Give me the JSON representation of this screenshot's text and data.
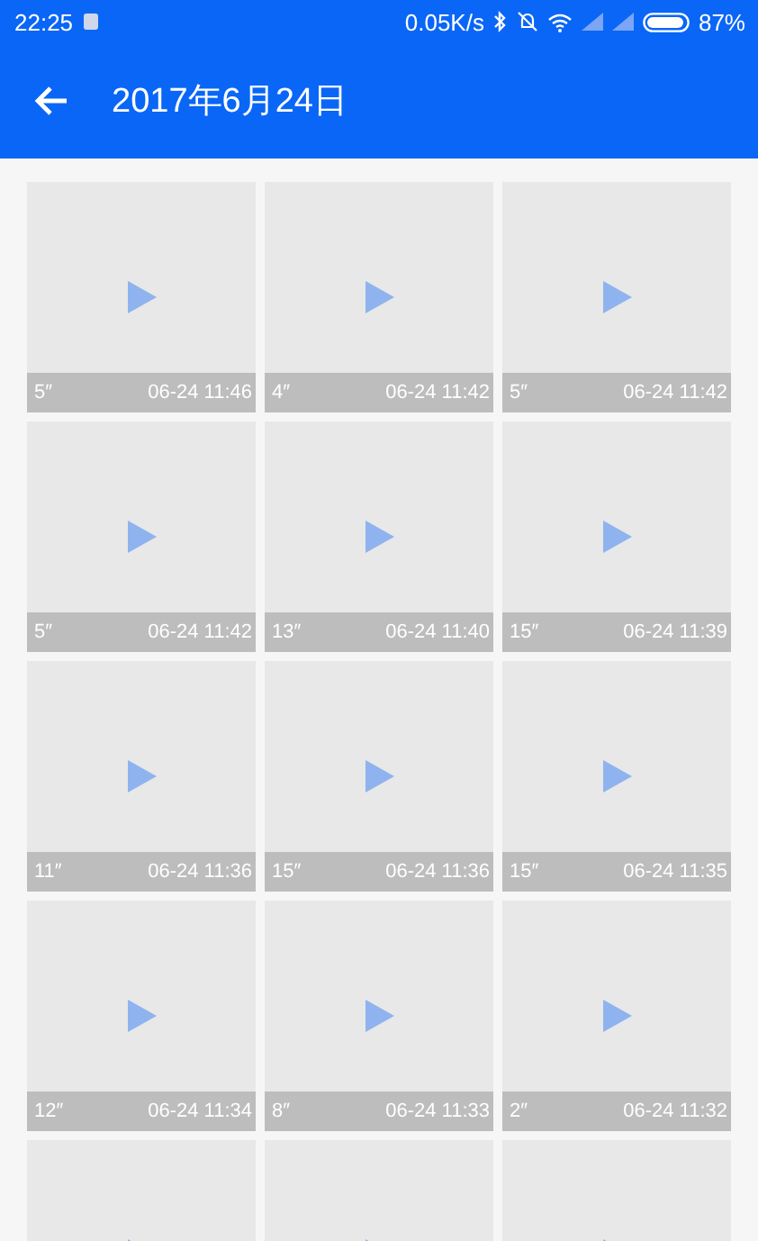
{
  "status_bar": {
    "time": "22:25",
    "speed": "0.05K/s",
    "battery": "87%"
  },
  "app_bar": {
    "title": "2017年6月24日"
  },
  "videos": [
    {
      "kind": "clip",
      "duration": "5″",
      "time": "06-24 11:46"
    },
    {
      "kind": "clip",
      "duration": "4″",
      "time": "06-24 11:42"
    },
    {
      "kind": "clip",
      "duration": "5″",
      "time": "06-24 11:42"
    },
    {
      "kind": "clip",
      "duration": "5″",
      "time": "06-24 11:42"
    },
    {
      "kind": "clip",
      "duration": "13″",
      "time": "06-24 11:40"
    },
    {
      "kind": "clip",
      "duration": "15″",
      "time": "06-24 11:39"
    },
    {
      "kind": "clip",
      "duration": "11″",
      "time": "06-24 11:36"
    },
    {
      "kind": "clip",
      "duration": "15″",
      "time": "06-24 11:36"
    },
    {
      "kind": "clip",
      "duration": "15″",
      "time": "06-24 11:35"
    },
    {
      "kind": "clip",
      "duration": "12″",
      "time": "06-24 11:34"
    },
    {
      "kind": "clip",
      "duration": "8″",
      "time": "06-24 11:33"
    },
    {
      "kind": "clip",
      "duration": "2″",
      "time": "06-24 11:32"
    },
    {
      "kind": "partial"
    },
    {
      "kind": "partial"
    },
    {
      "kind": "partial"
    }
  ]
}
